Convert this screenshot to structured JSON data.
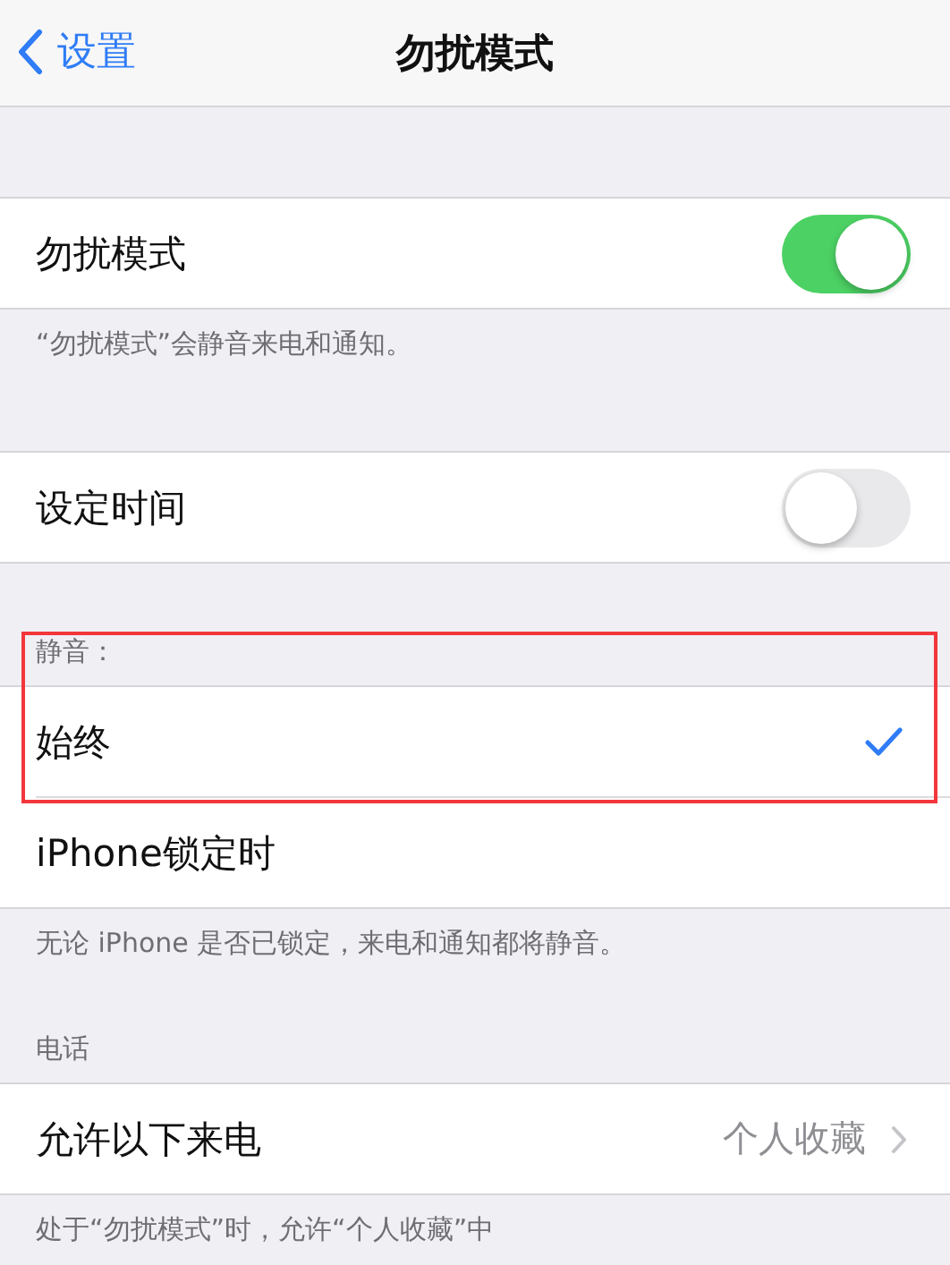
{
  "nav": {
    "back": "设置",
    "title": "勿扰模式"
  },
  "sections": [
    {
      "rows": [
        {
          "kind": "toggle",
          "label": "勿扰模式",
          "on": true
        }
      ],
      "footer": "“勿扰模式”会静音来电和通知。"
    },
    {
      "rows": [
        {
          "kind": "toggle",
          "label": "设定时间",
          "on": false
        }
      ]
    },
    {
      "header": "静音：",
      "highlighted": true,
      "rows": [
        {
          "kind": "choice",
          "label": "始终",
          "selected": true,
          "highlighted": true
        },
        {
          "kind": "choice",
          "label": "iPhone锁定时",
          "selected": false,
          "highlighted": false
        }
      ],
      "footer": "无论 iPhone 是否已锁定，来电和通知都将静音。"
    },
    {
      "header": "电话",
      "rows": [
        {
          "kind": "link",
          "label": "允许以下来电",
          "value": "个人收藏"
        }
      ],
      "footer": "处于“勿扰模式”时，允许“个人收藏”中"
    }
  ]
}
